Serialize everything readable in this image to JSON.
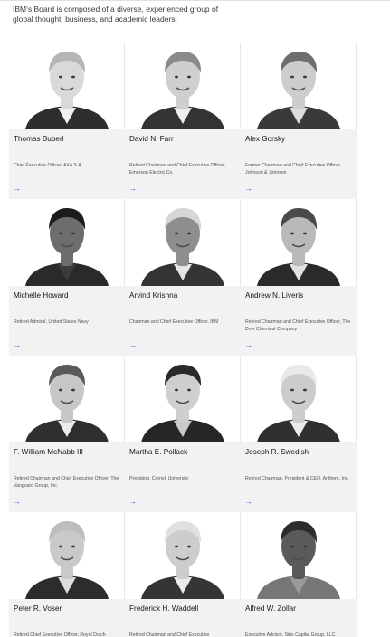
{
  "intro_text": "IBM’s Board is composed of a diverse, experienced group of global thought, business, and academic leaders.",
  "accent_color": "#0f62fe",
  "arrow_glyph": "→",
  "members": [
    {
      "name": "Thomas Buberl",
      "role": "Chief Executive Officer, AXA S.A.",
      "icon": "portrait-photo"
    },
    {
      "name": "David N. Farr",
      "role": "Retired Chairman and Chief Executive Officer, Emerson Electric Co.",
      "icon": "portrait-photo"
    },
    {
      "name": "Alex Gorsky",
      "role": "Former Chairman and Chief Executive Officer, Johnson & Johnson",
      "icon": "portrait-photo"
    },
    {
      "name": "Michelle Howard",
      "role": "Retired Admiral, United States Navy",
      "icon": "portrait-photo"
    },
    {
      "name": "Arvind Krishna",
      "role": "Chairman and Chief Executive Officer, IBM",
      "icon": "portrait-photo"
    },
    {
      "name": "Andrew N. Liveris",
      "role": "Retired Chairman and Chief Executive Officer, The Dow Chemical Company",
      "icon": "portrait-photo"
    },
    {
      "name": "F. William McNabb III",
      "role": "Retired Chairman and Chief Executive Officer, The Vanguard Group, Inc.",
      "icon": "portrait-photo"
    },
    {
      "name": "Martha E. Pollack",
      "role": "President, Cornell University",
      "icon": "portrait-photo"
    },
    {
      "name": "Joseph R. Swedish",
      "role": "Retired Chairman, President & CEO, Anthem, Inc.",
      "icon": "portrait-photo"
    },
    {
      "name": "Peter R. Voser",
      "role": "Retired Chief Executive Officer, Royal Dutch",
      "icon": "portrait-photo"
    },
    {
      "name": "Frederick H. Waddell",
      "role": "Retired Chairman and Chief Executive",
      "icon": "portrait-photo"
    },
    {
      "name": "Alfred W. Zollar",
      "role": "Executive Advisor, Siris Capital Group, LLC",
      "icon": "portrait-photo"
    }
  ]
}
